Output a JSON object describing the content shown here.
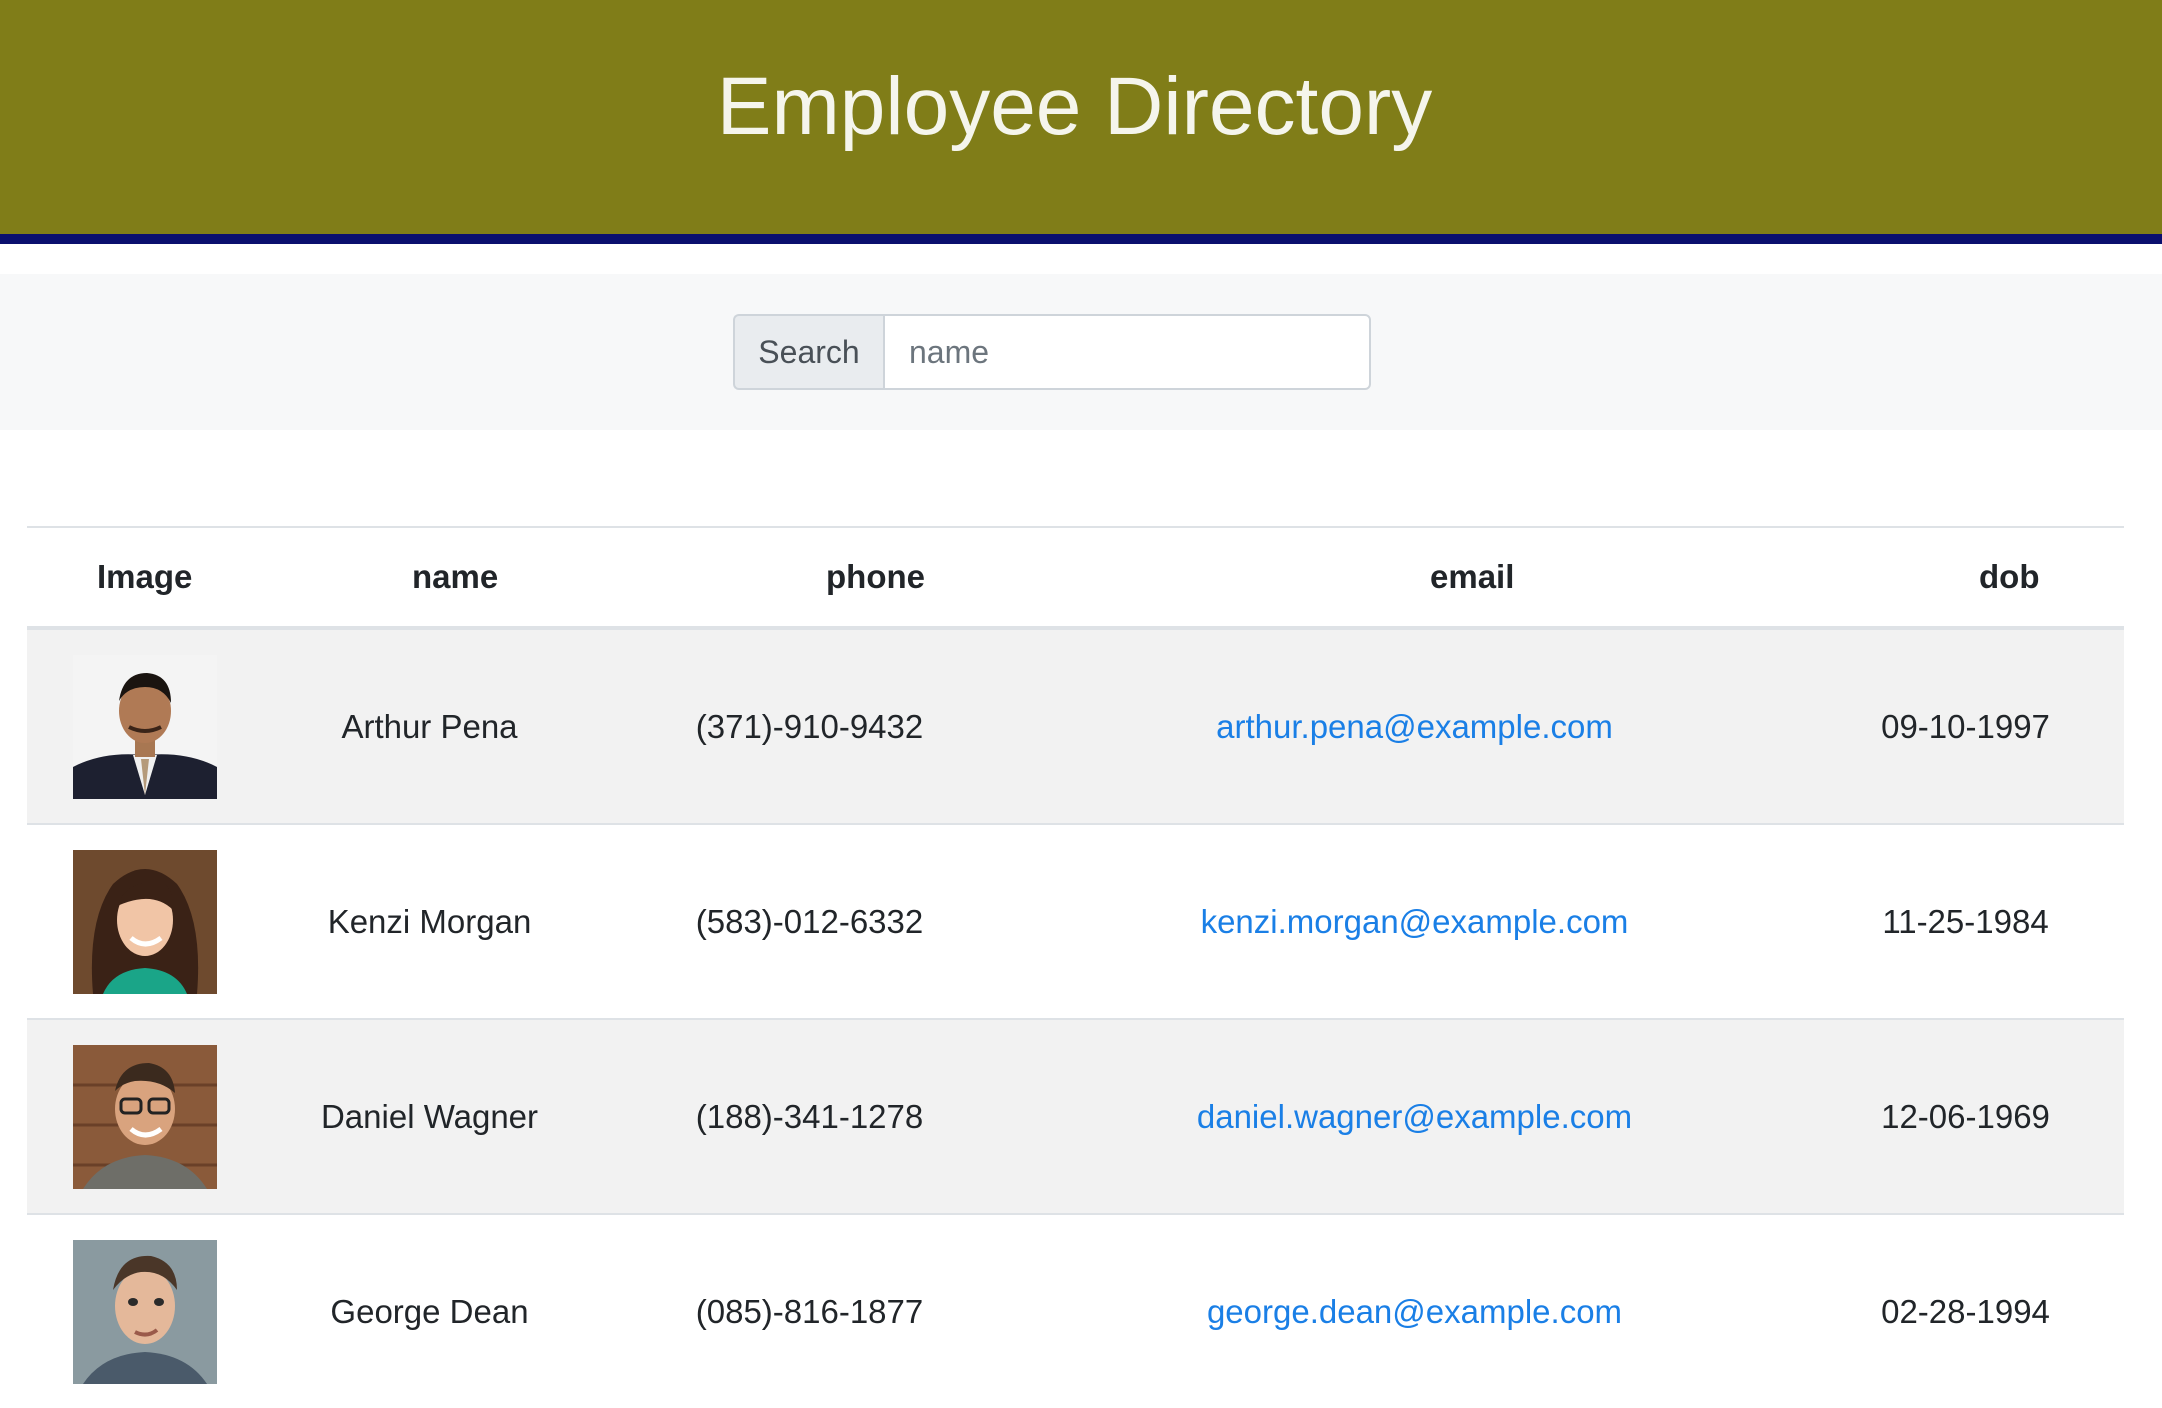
{
  "header": {
    "title": "Employee Directory"
  },
  "search": {
    "label": "Search",
    "placeholder": "name"
  },
  "table": {
    "columns": [
      "Image",
      "name",
      "phone",
      "email",
      "dob"
    ],
    "rows": [
      {
        "name": "Arthur Pena",
        "phone": "(371)-910-9432",
        "email": "arthur.pena@example.com",
        "dob": "09-10-1997"
      },
      {
        "name": "Kenzi Morgan",
        "phone": "(583)-012-6332",
        "email": "kenzi.morgan@example.com",
        "dob": "11-25-1984"
      },
      {
        "name": "Daniel Wagner",
        "phone": "(188)-341-1278",
        "email": "daniel.wagner@example.com",
        "dob": "12-06-1969"
      },
      {
        "name": "George Dean",
        "phone": "(085)-816-1877",
        "email": "george.dean@example.com",
        "dob": "02-28-1994"
      }
    ]
  },
  "colors": {
    "header_bg": "#807d18",
    "header_border": "#0a0f6e",
    "link": "#1a7fe6",
    "stripe": "#f2f2f2"
  }
}
